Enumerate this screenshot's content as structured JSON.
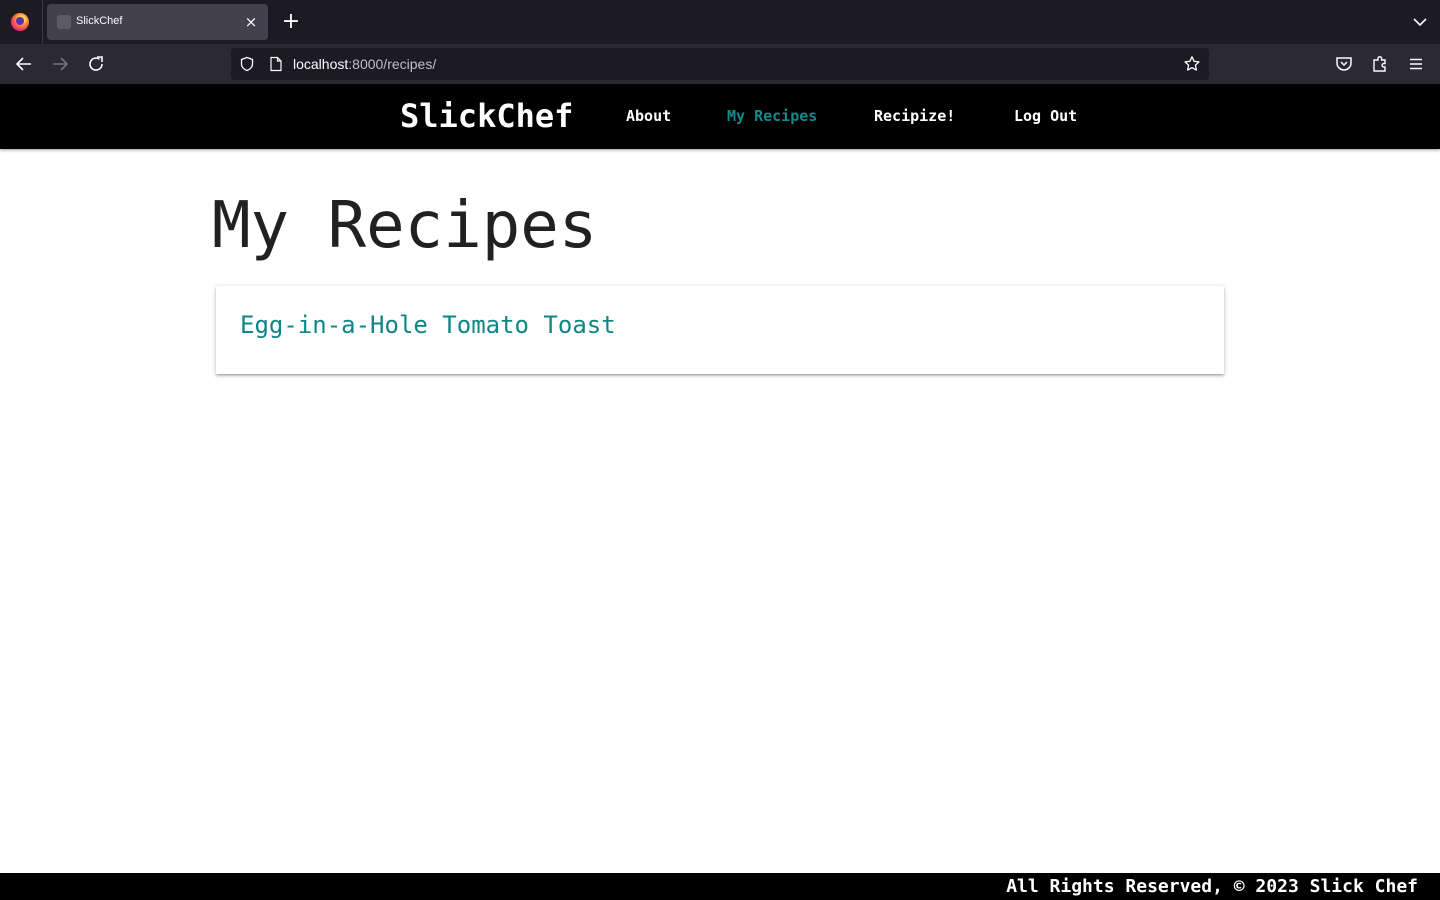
{
  "browser": {
    "tab": {
      "title": "SlickChef",
      "close_glyph": "×"
    },
    "new_tab_glyph": "+",
    "url": {
      "host": "localhost",
      "rest": ":8000/recipes/"
    },
    "icons": {
      "app": "firefox-logo-icon",
      "tablist": "chevron-down-icon",
      "back": "arrow-left-icon",
      "forward": "arrow-right-icon",
      "reload": "reload-icon",
      "security": "shield-icon",
      "page": "page-icon",
      "bookmark": "star-icon",
      "pocket": "pocket-icon",
      "extensions": "puzzle-icon",
      "menu": "hamburger-menu-icon"
    }
  },
  "site": {
    "brand": "SlickChef",
    "nav": [
      {
        "label": "About",
        "active": false
      },
      {
        "label": "My Recipes",
        "active": true
      },
      {
        "label": "Recipize!",
        "active": false
      },
      {
        "label": "Log Out",
        "active": false
      }
    ]
  },
  "main": {
    "title": "My Recipes",
    "recipes": [
      {
        "name": "Egg-in-a-Hole Tomato Toast"
      }
    ]
  },
  "footer": {
    "text": "All Rights Reserved, © 2023 Slick Chef"
  },
  "colors": {
    "accent": "#138a8a",
    "header_bg": "#000000",
    "footer_bg": "#000000"
  }
}
